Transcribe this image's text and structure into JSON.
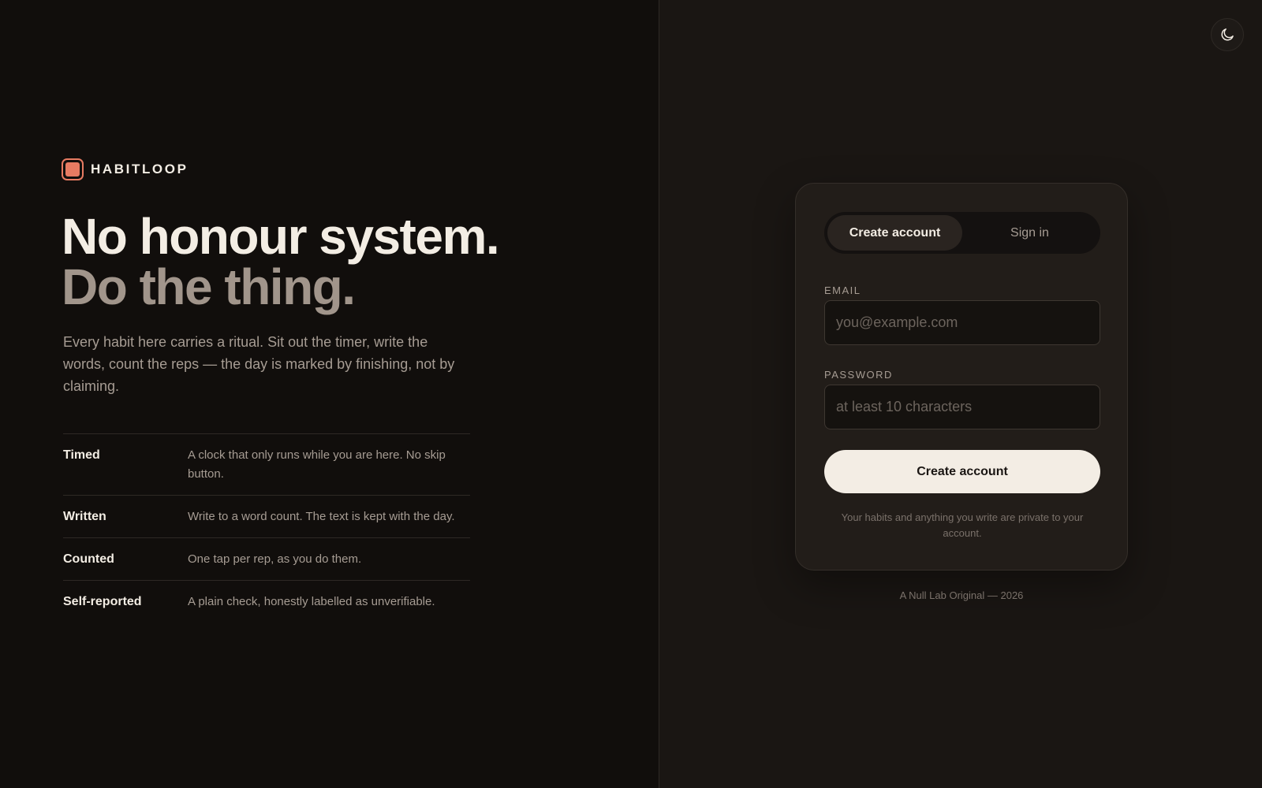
{
  "brand": {
    "name": "HABITLOOP",
    "logo_icon": "square-logo-icon",
    "accent": "#e77b62"
  },
  "hero": {
    "headline_line1": "No honour system.",
    "headline_line2": "Do the thing.",
    "lede": "Every habit here carries a ritual. Sit out the timer, write the words, count the reps — the day is marked by finishing, not by claiming."
  },
  "features": [
    {
      "name": "Timed",
      "description": "A clock that only runs while you are here. No skip button."
    },
    {
      "name": "Written",
      "description": "Write to a word count. The text is kept with the day."
    },
    {
      "name": "Counted",
      "description": "One tap per rep, as you do them."
    },
    {
      "name": "Self-reported",
      "description": "A plain check, honestly labelled as unverifiable."
    }
  ],
  "theme_toggle": {
    "icon": "moon-icon"
  },
  "auth": {
    "tabs": [
      {
        "label": "Create account",
        "active": true
      },
      {
        "label": "Sign in",
        "active": false
      }
    ],
    "email": {
      "label": "EMAIL",
      "value": "",
      "placeholder": "you@example.com"
    },
    "password": {
      "label": "PASSWORD",
      "value": "",
      "placeholder": "at least 10 characters"
    },
    "submit_label": "Create account",
    "privacy_note": "Your habits and anything you write are private to your account."
  },
  "footer": {
    "text": "A Null Lab Original — 2026"
  }
}
